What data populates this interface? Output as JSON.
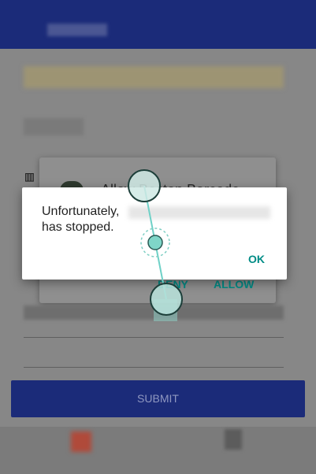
{
  "background_app": {
    "permission_title": "Allow Boston Barcode",
    "permission_deny": "DENY",
    "permission_allow": "ALLOW",
    "submit_label": "SUBMIT",
    "barcode_icon": "barcode-icon"
  },
  "crash_dialog": {
    "message_line1": "Unfortunately,",
    "message_line2": "has stopped.",
    "ok_label": "OK"
  },
  "colors": {
    "appbar": "#1b2b79",
    "accent": "#008c86",
    "gesture": "#6fd1c7"
  }
}
